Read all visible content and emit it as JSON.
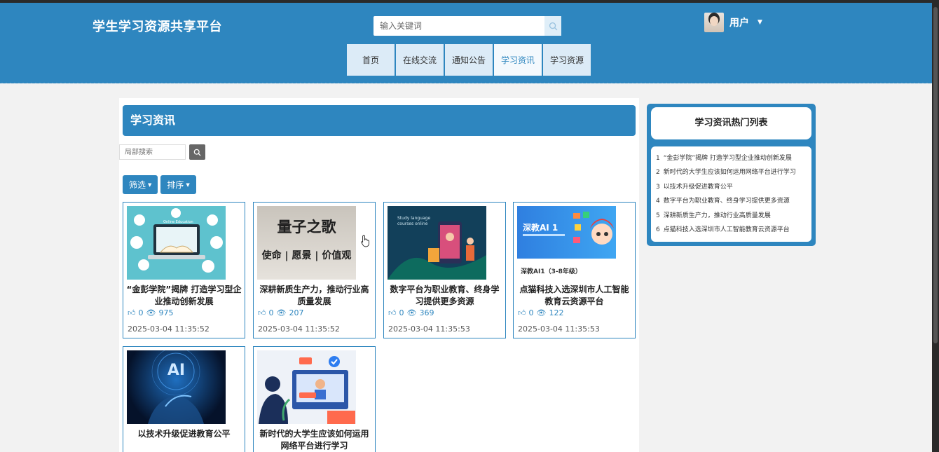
{
  "header": {
    "site_title": "学生学习资源共享平台",
    "search_placeholder": "输入关键词",
    "user_name": "用户",
    "nav": [
      {
        "label": "首页"
      },
      {
        "label": "在线交流"
      },
      {
        "label": "通知公告"
      },
      {
        "label": "学习资讯"
      },
      {
        "label": "学习资源"
      }
    ],
    "active_nav": "学习资讯"
  },
  "main": {
    "heading": "学习资讯",
    "local_search_placeholder": "局部搜索",
    "filter_label": "筛选",
    "sort_label": "排序",
    "cards": [
      {
        "title": "“金彭学院”揭牌 打造学习型企业推动创新发展",
        "likes": "0",
        "views": "975",
        "date": "2025-03-04 11:35:52",
        "image": "online-education-illustration"
      },
      {
        "title": "深耕新质生产力，推动行业高质量发展",
        "likes": "0",
        "views": "207",
        "date": "2025-03-04 11:35:52",
        "image": "quantum-song-poster",
        "image_text": [
          "量子之歌",
          "使命 | 愿景 | 价值观"
        ]
      },
      {
        "title": "数字平台为职业教育、终身学习提供更多资源",
        "likes": "0",
        "views": "369",
        "date": "2025-03-04 11:35:53",
        "image": "study-language-online",
        "image_text": [
          "Study language",
          "courses online"
        ]
      },
      {
        "title": "点猫科技入选深圳市人工智能教育云资源平台",
        "likes": "0",
        "views": "122",
        "date": "2025-03-04 11:35:53",
        "image": "deep-ai-banner",
        "image_text": [
          "深教AI 1"
        ],
        "sub_label": "深教AI1（3-8年级）"
      },
      {
        "title": "以技术升级促进教育公平",
        "image": "ai-robot-hand",
        "image_text": [
          "AI"
        ]
      },
      {
        "title": "新时代的大学生应该如何运用网络平台进行学习",
        "image": "online-meeting-illustration"
      }
    ]
  },
  "sidebar": {
    "hot_title": "学习资讯热门列表",
    "hot_items": [
      {
        "n": "1",
        "text": "“金彭学院”揭牌 打造学习型企业推动创新发展"
      },
      {
        "n": "2",
        "text": "新时代的大学生应该如何运用网络平台进行学习"
      },
      {
        "n": "3",
        "text": "以技术升级促进教育公平"
      },
      {
        "n": "4",
        "text": "数字平台为职业教育、终身学习提供更多资源"
      },
      {
        "n": "5",
        "text": "深耕新质生产力，推动行业高质量发展"
      },
      {
        "n": "6",
        "text": "点猫科技入选深圳市人工智能教育云资源平台"
      }
    ]
  },
  "colors": {
    "primary": "#2e86bf",
    "nav_bg": "#dcebf7",
    "page_bg": "#f2f2f2"
  }
}
